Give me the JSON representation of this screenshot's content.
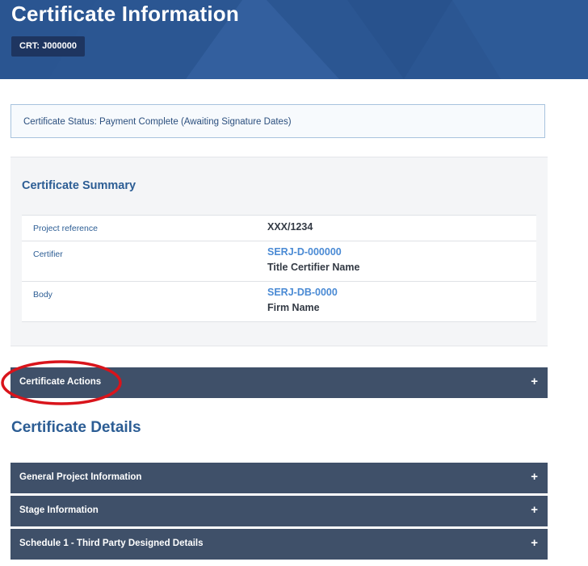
{
  "header": {
    "title": "Certificate Information",
    "crt_badge": "CRT: J000000",
    "background_color": "#2b5692"
  },
  "status": {
    "text": "Certificate Status: Payment Complete (Awaiting Signature Dates)"
  },
  "summary": {
    "title": "Certificate Summary",
    "rows": [
      {
        "label": "Project reference",
        "value": "XXX/1234"
      },
      {
        "label": "Certifier",
        "link": "SERJ-D-000000",
        "sub": "Title Certifier Name"
      },
      {
        "label": "Body",
        "link": "SERJ-DB-0000",
        "sub": "Firm Name"
      }
    ]
  },
  "actions": {
    "label": "Certificate Actions",
    "expand_icon": "+",
    "highlight_color": "#d9141b"
  },
  "details": {
    "heading": "Certificate Details",
    "sections": [
      {
        "label": "General Project Information",
        "expand_icon": "+"
      },
      {
        "label": "Stage Information",
        "expand_icon": "+"
      },
      {
        "label": "Schedule 1 - Third Party Designed Details",
        "expand_icon": "+"
      }
    ]
  },
  "colors": {
    "accent": "#2c5d94",
    "link": "#4a8ad4",
    "accordion": "#3f5069"
  }
}
